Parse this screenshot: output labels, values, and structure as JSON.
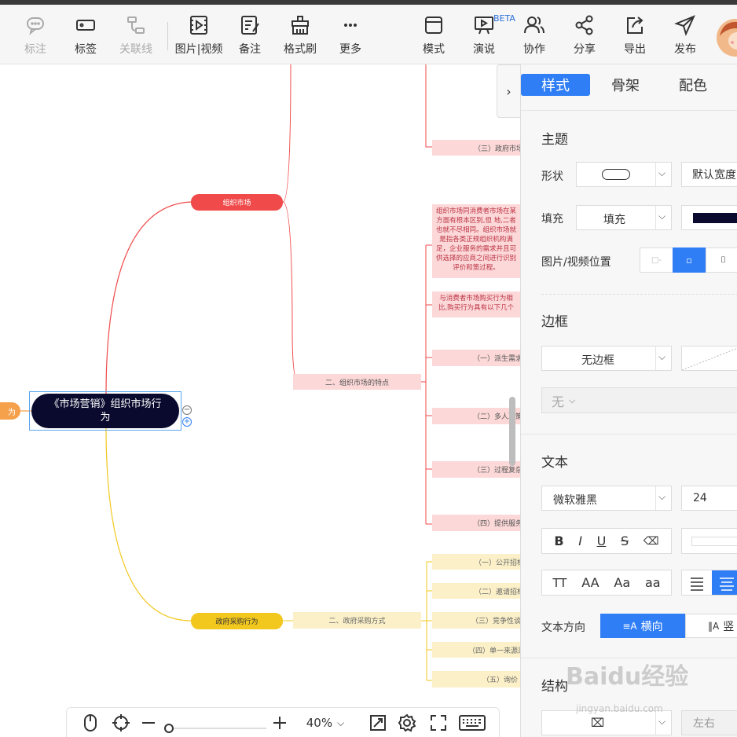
{
  "toolbar": {
    "items": [
      {
        "label": "标注",
        "icon": "comment-icon",
        "disabled": true
      },
      {
        "label": "标签",
        "icon": "tag-icon",
        "disabled": false
      },
      {
        "label": "关联线",
        "icon": "relation-line-icon",
        "disabled": true
      },
      {
        "label": "图片|视频",
        "icon": "media-icon",
        "disabled": false
      },
      {
        "label": "备注",
        "icon": "note-icon",
        "disabled": false
      },
      {
        "label": "格式刷",
        "icon": "format-brush-icon",
        "disabled": false
      },
      {
        "label": "更多",
        "icon": "more-icon",
        "disabled": false
      },
      {
        "label": "模式",
        "icon": "mode-icon",
        "disabled": false
      },
      {
        "label": "演说",
        "icon": "presentation-icon",
        "disabled": false
      },
      {
        "label": "协作",
        "icon": "collaborate-icon",
        "disabled": false
      },
      {
        "label": "分享",
        "icon": "share-icon",
        "disabled": false
      },
      {
        "label": "导出",
        "icon": "export-icon",
        "disabled": false
      },
      {
        "label": "发布",
        "icon": "publish-icon",
        "disabled": false
      }
    ],
    "beta": "BETA"
  },
  "mindmap": {
    "root": "《市场营销》组织市场行为",
    "left_stub": "为",
    "branch1": "组织市场",
    "branch2": "政府采购行为",
    "sub1": "二、组织市场的特点",
    "sub2": "二、政府采购方式",
    "top_item": "（三）政府市场",
    "para1": "组织市场同消费者市场在某方面有根本区别,但 地,二者也就不尽相同。组织市场就是指各类正规组织机构满足，企业服务的需求并且可供选择的应商之间进行识别 评价和策过程。",
    "para2": "与消费者市场购买行为相比,购买行为具有以下几个",
    "pink_items": [
      "（一）派生需求",
      "（二）多人决策",
      "（三）过程复杂",
      "（四）提供服务"
    ],
    "yellow_items": [
      "（一）公开招标",
      "（二）邀请招标",
      "（三）竞争性谈判",
      "（四）单一来源采购",
      "（五）询价"
    ],
    "colors": {
      "root": "#0a0a2e",
      "red": "#f04a4a",
      "yellow": "#f2c71e",
      "orange": "#f5a04a"
    }
  },
  "panel": {
    "tabs": [
      "样式",
      "骨架",
      "配色"
    ],
    "theme_title": "主题",
    "shape_label": "形状",
    "width_value": "默认宽度",
    "fill_label": "填充",
    "fill_value": "填充",
    "fill_color": "#0a0a2e",
    "media_pos_label": "图片/视频位置",
    "border_title": "边框",
    "border_value": "无边框",
    "border_extra": "无",
    "text_title": "文本",
    "font_value": "微软雅黑",
    "size_value": "24",
    "text_dir_label": "文本方向",
    "dir_horizontal": "横向",
    "dir_vertical": "竖",
    "structure_title": "结构",
    "struct_value": "左右",
    "case_buttons": [
      "TT",
      "AA",
      "Aa",
      "aa"
    ]
  },
  "bottom": {
    "zoom": "40%"
  },
  "watermark": {
    "main": "Baidu经验",
    "sub": "jingyan.baidu.com"
  }
}
